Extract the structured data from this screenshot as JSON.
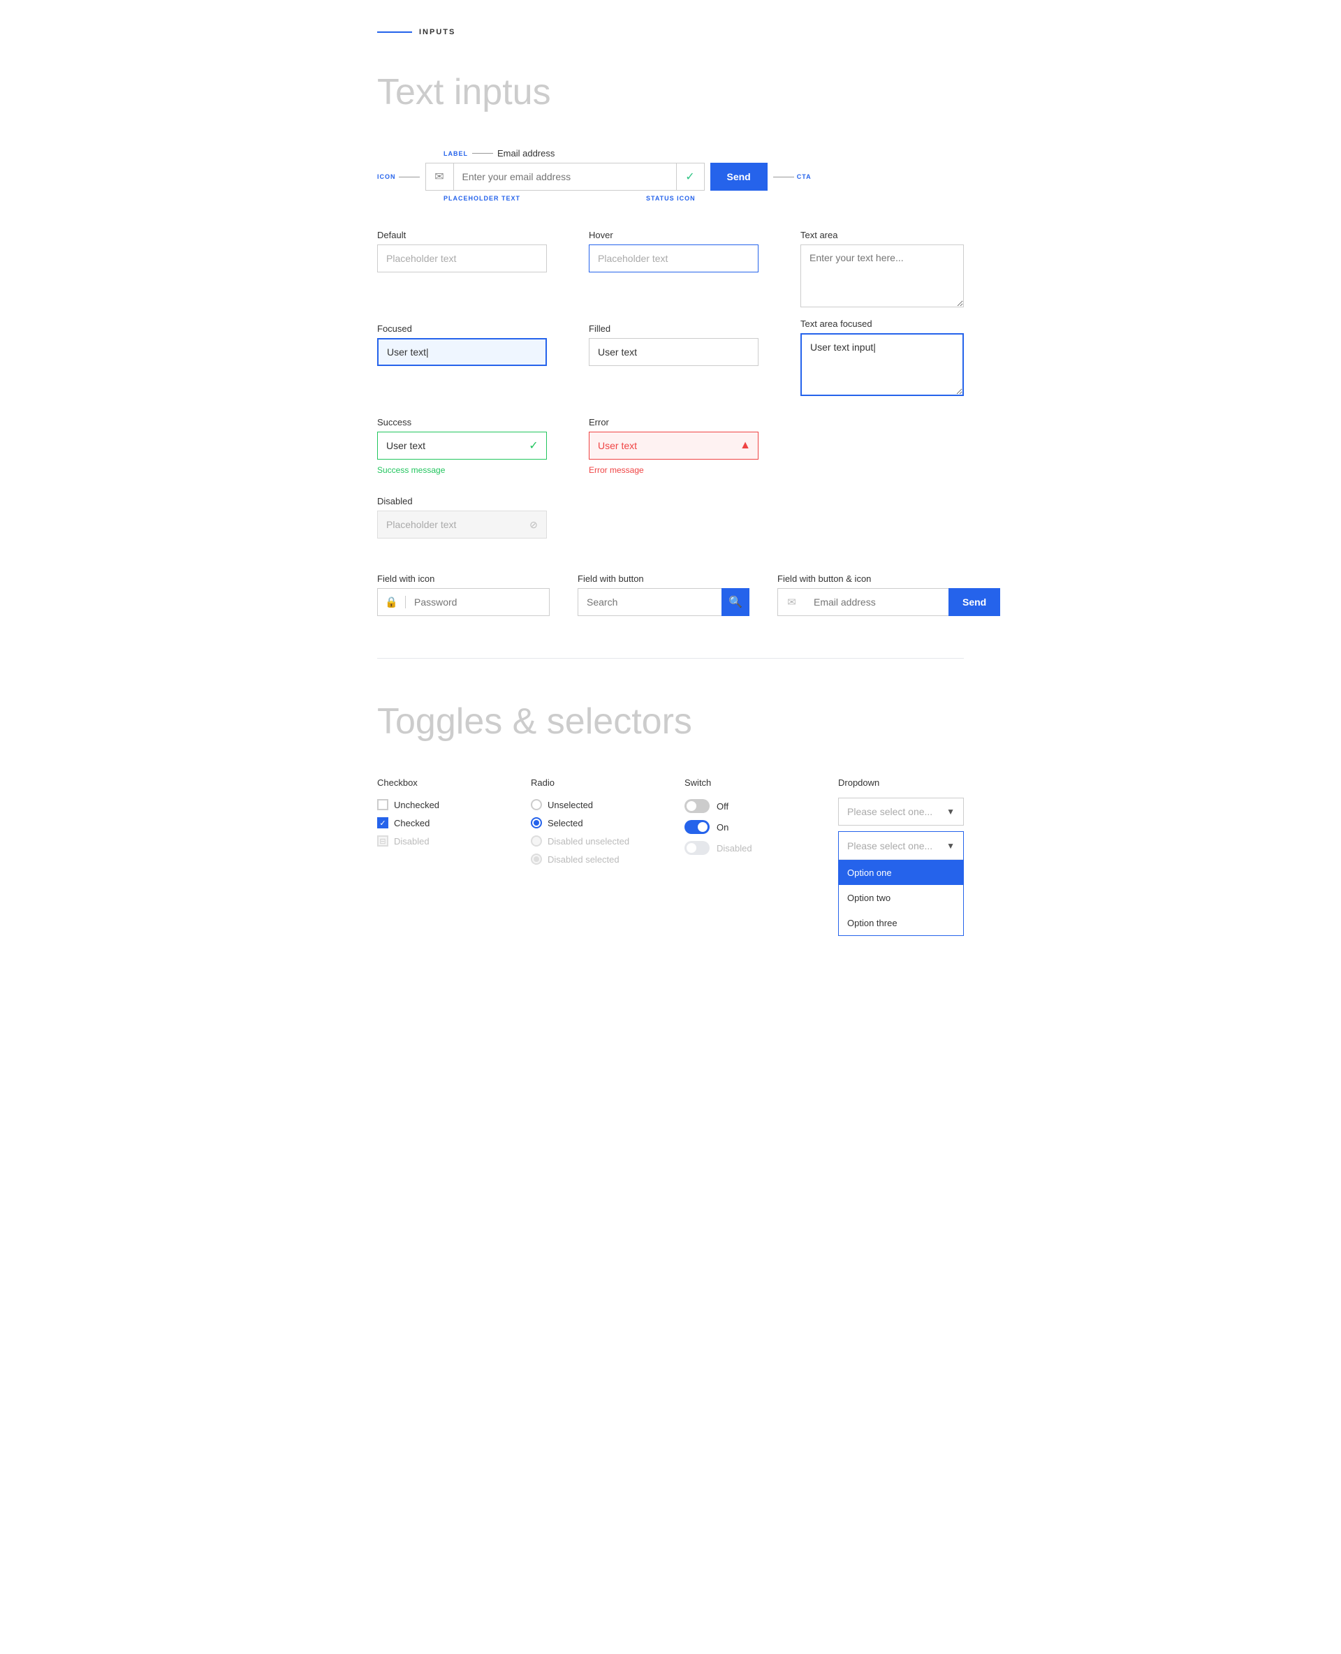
{
  "section1": {
    "header": "INPUTS",
    "heading": "Text inptus"
  },
  "anatomy": {
    "label_ann": "LABEL",
    "icon_ann": "ICON",
    "placeholder_ann": "PLACEHOLDER TEXT",
    "status_ann": "STATUS ICON",
    "cta_ann": "CTA",
    "field_label": "Email address",
    "input_placeholder": "Enter your email address",
    "send_label": "Send"
  },
  "states": {
    "default_label": "Default",
    "default_placeholder": "Placeholder text",
    "hover_label": "Hover",
    "hover_placeholder": "Placeholder text",
    "focused_label": "Focused",
    "focused_value": "User text|",
    "filled_label": "Filled",
    "filled_value": "User text",
    "success_label": "Success",
    "success_value": "User text",
    "success_msg": "Success message",
    "error_label": "Error",
    "error_value": "User text",
    "error_msg": "Error message",
    "disabled_label": "Disabled",
    "disabled_placeholder": "Placeholder text"
  },
  "textarea": {
    "label": "Text area",
    "placeholder": "Enter your text here...",
    "focused_label": "Text area focused",
    "focused_value": "User text input|"
  },
  "fields_special": {
    "icon_label": "Field with icon",
    "icon_placeholder": "Password",
    "btn_label": "Field with button",
    "btn_placeholder": "Search",
    "btn_icon_label": "Field with button & icon",
    "btn_icon_placeholder": "Email address",
    "send_label": "Send"
  },
  "section2": {
    "heading": "Toggles & selectors"
  },
  "checkbox": {
    "title": "Checkbox",
    "unchecked_label": "Unchecked",
    "checked_label": "Checked",
    "disabled_label": "Disabled"
  },
  "radio": {
    "title": "Radio",
    "unselected_label": "Unselected",
    "selected_label": "Selected",
    "disabled_unselected_label": "Disabled unselected",
    "disabled_selected_label": "Disabled selected"
  },
  "switch_ctrl": {
    "title": "Switch",
    "off_label": "Off",
    "on_label": "On",
    "disabled_label": "Disabled"
  },
  "dropdown": {
    "title": "Dropdown",
    "placeholder1": "Please select one...",
    "placeholder2": "Please select one...",
    "options": [
      "Option one",
      "Option two",
      "Option three"
    ]
  }
}
